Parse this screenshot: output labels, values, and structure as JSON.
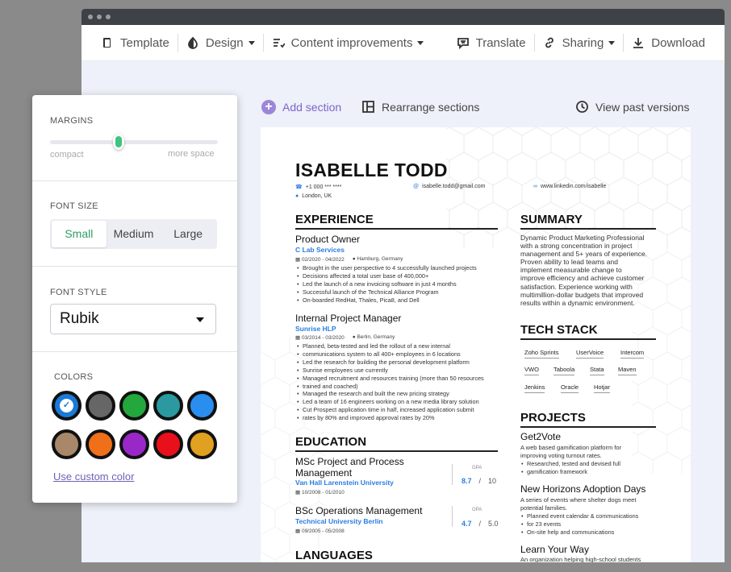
{
  "toolbar": {
    "template": "Template",
    "design": "Design",
    "content_improvements": "Content improvements",
    "translate": "Translate",
    "sharing": "Sharing",
    "download": "Download"
  },
  "actions": {
    "add_section": "Add section",
    "rearrange": "Rearrange sections",
    "past_versions": "View past versions"
  },
  "panel": {
    "margins_label": "MARGINS",
    "margin_min": "compact",
    "margin_max": "more space",
    "margin_value": 0.41,
    "font_size_label": "FONT SIZE",
    "font_sizes": [
      "Small",
      "Medium",
      "Large"
    ],
    "font_size_selected": "Small",
    "font_style_label": "FONT STYLE",
    "font_style_value": "Rubik",
    "colors_label": "COLORS",
    "colors": [
      "#1a7ad9",
      "#666666",
      "#22a83c",
      "#2a9aa0",
      "#2a8ef0",
      "#a8876a",
      "#f0701a",
      "#9a28c8",
      "#e8101a",
      "#e0a020"
    ],
    "selected_color": "#1a7ad9",
    "custom_color": "Use custom color"
  },
  "resume": {
    "name": "ISABELLE TODD",
    "phone": "+1 000 *** ****",
    "email": "isabelle.todd@gmail.com",
    "linkedin": "www.linkedin.com/isabelle",
    "location": "London, UK",
    "experience_title": "EXPERIENCE",
    "jobs": [
      {
        "title": "Product Owner",
        "company": "C Lab Services",
        "dates": "02/2020 - 04/2022",
        "location": "Hamburg, Germany",
        "bullets": [
          "Brought in the user perspective to 4 successfully launched projects",
          "Decisions affected a total user base of 400,000+",
          "Led the launch of a new invoicing software in just 4 months",
          "Successful launch of the Technical Alliance Program",
          "On-boarded RedHat, Thales, Pica8, and Dell"
        ]
      },
      {
        "title": "Internal Project Manager",
        "company": "Sunrise HLP",
        "dates": "03/2014 - 03/2020",
        "location": "Berlin, Germany",
        "bullets": [
          "Planned, beta-tested and led the rollout of a new internal",
          "communications system to all 400+ employees in 6 locations",
          "Led the research for building the personal development platform",
          "Sunrise employees use currently",
          "Managed recruitment and resources training (more than 50 resources",
          "trained and coached)",
          "Managed the research and built the new pricing strategy",
          "Led a team of 16 engineers working on a new media library solution",
          "Cut Prospect application time in half, increased application submit",
          "rates by 80% and improved approval rates by 20%"
        ]
      }
    ],
    "education_title": "EDUCATION",
    "education": [
      {
        "degree_line1": "MSc Project and Process",
        "degree_line2": "Management",
        "school": "Van Hall Larenstein University",
        "dates": "10/2008 - 01/2010",
        "gpa_label": "GPA",
        "gpa": "8.7",
        "gpa_max": "10"
      },
      {
        "degree_line1": "BSc Operations Management",
        "school": "Technical University Berlin",
        "dates": "09/2005 - 05/2008",
        "gpa_label": "GPA",
        "gpa": "4.7",
        "gpa_max": "5.0"
      }
    ],
    "languages_title": "LANGUAGES",
    "summary_title": "SUMMARY",
    "summary_lines": [
      "Dynamic Product Marketing Professional",
      "with a strong concentration in project",
      "management and 5+ years of experience.",
      "Proven ability to lead teams and",
      "implement measurable change to",
      "improve efficiency and achieve customer",
      "satisfaction. Experience working with",
      "multimillion-dollar budgets that improved",
      "results within a dynamic environment."
    ],
    "tech_title": "TECH STACK",
    "tech": [
      "Zoho Sprints",
      "UserVoice",
      "Intercom",
      "VWO",
      "Taboola",
      "Stata",
      "Maven",
      "Jenkins",
      "Oracle",
      "Hotjar"
    ],
    "projects_title": "PROJECTS",
    "projects": [
      {
        "name": "Get2Vote",
        "desc": [
          "A web based gamification platform for",
          "improving voting turnout rates."
        ],
        "bullets": [
          "Researched, tested and devised full",
          "gamification framework"
        ]
      },
      {
        "name": "New Horizons Adoption Days",
        "desc": [
          "A series of events where shelter dogs meet",
          "potential families."
        ],
        "bullets": [
          "Planned event calendar & communications",
          "for 23 events",
          "On-site help and communications"
        ]
      },
      {
        "name": "Learn Your Way",
        "desc": [
          "An organization helping high-school students"
        ]
      }
    ]
  }
}
